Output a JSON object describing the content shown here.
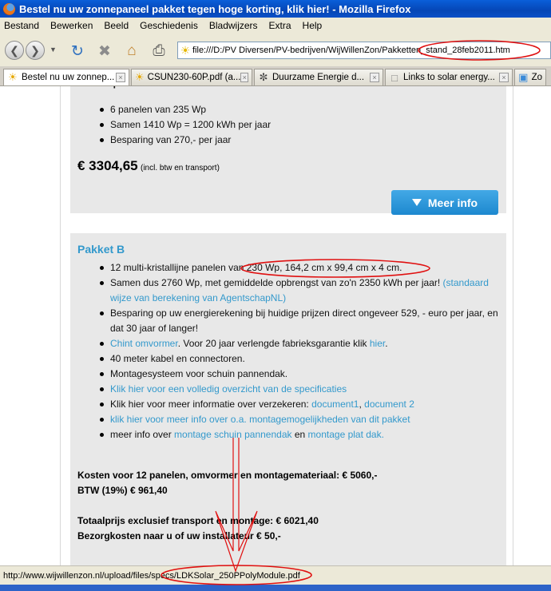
{
  "window": {
    "title": "Bestel nu uw zonnepaneel pakket tegen hoge korting, klik hier! - Mozilla Firefox"
  },
  "menu": [
    "Bestand",
    "Bewerken",
    "Beeld",
    "Geschiedenis",
    "Bladwijzers",
    "Extra",
    "Help"
  ],
  "toolbar": {
    "back_icon": "back-arrow-icon",
    "forward_icon": "forward-arrow-icon",
    "reload_icon": "reload-icon",
    "stop_icon": "stop-icon",
    "home_icon": "home-icon",
    "print_icon": "printer-icon",
    "url": "file:///D:/PV Diversen/PV-bedrijven/WijWillenZon/Pakketten_stand_28feb2011.htm"
  },
  "tabs": [
    {
      "label": "Bestel nu uw zonnep...",
      "icon": "sun-icon"
    },
    {
      "label": "CSUN230-60P.pdf (a...",
      "icon": "sun-icon"
    },
    {
      "label": "Duurzame Energie d...",
      "icon": "swirl-icon"
    },
    {
      "label": "Links to solar energy...",
      "icon": "page-icon"
    },
    {
      "label": "Zo",
      "icon": "image-icon"
    }
  ],
  "pakket_a": {
    "items": [
      "6 panelen van 235 Wp",
      "Samen 1410 Wp = 1200 kWh per jaar",
      "Besparing van 270,- per jaar"
    ],
    "price": "€ 3304,65",
    "price_note": "(incl. btw en transport)",
    "button": "Meer info"
  },
  "pakket_b": {
    "title": "Pakket B",
    "item1": "12 multi-kristallijne panelen van 230 Wp, 164,2 cm x 99,4 cm x 4 cm.",
    "item2_text": "Samen dus 2760 Wp, met gemiddelde opbrengst van zo'n 2350 kWh per jaar!",
    "item2_link": "(standaard wijze van berekening van AgentschapNL)",
    "item3": "Besparing op uw energierekening bij huidige prijzen direct ongeveer 529, - euro per jaar, en dat 30 jaar of langer!",
    "item4_link": "Chint omvormer",
    "item4_text": ". Voor 20 jaar verlengde fabrieksgarantie klik",
    "item4_link2": "hier",
    "item5": "40 meter kabel en connectoren.",
    "item6": "Montagesysteem voor schuin pannendak.",
    "item7_link": "Klik hier voor een volledig overzicht van de specificaties",
    "item8_text": "Klik hier voor meer informatie over verzekeren:",
    "item8_link1": "document1",
    "item8_link2": "document 2",
    "item9_link": "klik hier voor meer info over o.a. montagemogelijkheden van dit pakket",
    "item10_text": "meer info over",
    "item10_link1": "montage schuin pannendak",
    "item10_and": "en",
    "item10_link2": "montage plat dak.",
    "cost_line1": "Kosten voor 12 panelen, omvormer en montagemateriaal: € 5060,-",
    "cost_line2": "BTW (19%) € 961,40",
    "cost_line3": "Totaalprijs exclusief transport en montage: €  6021,40",
    "cost_line4": "Bezorgkosten naar u of uw installateur € 50,-"
  },
  "statusbar": {
    "url": "http://www.wijwillenzon.nl/upload/files/specs/LDKSolar_250PPolyModule.pdf"
  },
  "annotation_color": "#e01010"
}
